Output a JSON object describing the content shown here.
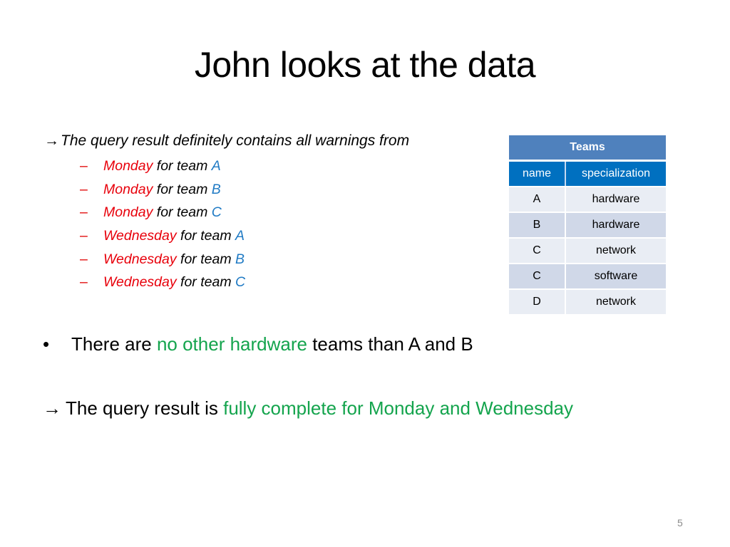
{
  "slide": {
    "title": "John looks at the data",
    "page_number": "5"
  },
  "intro": {
    "arrow_icon": "→",
    "text": "The query result definitely contains all warnings from"
  },
  "items": [
    {
      "dash": "–",
      "day": "Monday",
      "mid": " for team ",
      "team": "A"
    },
    {
      "dash": "–",
      "day": "Monday",
      "mid": " for team ",
      "team": "B"
    },
    {
      "dash": "–",
      "day": "Monday",
      "mid": " for team ",
      "team": "C"
    },
    {
      "dash": "–",
      "day": "Wednesday",
      "mid": " for team ",
      "team": "A"
    },
    {
      "dash": "–",
      "day": "Wednesday",
      "mid": " for team ",
      "team": "B"
    },
    {
      "dash": "–",
      "day": "Wednesday",
      "mid": " for team ",
      "team": "C"
    }
  ],
  "bullet": {
    "symbol": "•",
    "pre": "There are ",
    "highlight": "no other hardware",
    "post": " teams than A and B"
  },
  "conclusion": {
    "arrow_icon": "→",
    "pre": "The query result is ",
    "highlight": "fully complete for Monday and Wednesday"
  },
  "table": {
    "caption": "Teams",
    "columns": [
      "name",
      "specialization"
    ],
    "rows": [
      [
        "A",
        "hardware"
      ],
      [
        "B",
        "hardware"
      ],
      [
        "C",
        "network"
      ],
      [
        "C",
        "software"
      ],
      [
        "D",
        "network"
      ]
    ]
  },
  "colors": {
    "day": "#e8000b",
    "team": "#1f7ac4",
    "highlight": "#14a44d",
    "table_caption_bg": "#4f81bd",
    "table_header_bg": "#0070c0"
  }
}
